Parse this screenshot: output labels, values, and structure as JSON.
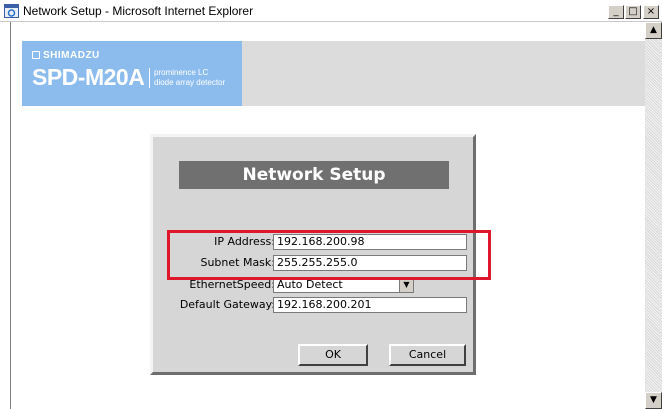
{
  "window": {
    "title": "Network Setup - Microsoft Internet Explorer",
    "buttons": {
      "minimize": "_",
      "maximize": "□",
      "close": "×"
    }
  },
  "scrollbar": {
    "up_arrow": "▲",
    "down_arrow": "▼"
  },
  "header": {
    "brand": "SHIMADZU",
    "model": "SPD-M20A",
    "tagline_1": "prominence LC",
    "tagline_2": "diode array detector",
    "colors": {
      "logo_bg": "#8cbcee",
      "bar_bg": "#dcdcdc"
    }
  },
  "dialog": {
    "title": "Network Setup",
    "fields": {
      "ip_address": {
        "label": "IP Address:",
        "value": "192.168.200.98"
      },
      "subnet_mask": {
        "label": "Subnet Mask:",
        "value": "255.255.255.0"
      },
      "ethernet_speed": {
        "label": "EthernetSpeed:",
        "value": "Auto Detect"
      },
      "default_gateway": {
        "label": "Default Gateway:",
        "value": "192.168.200.201"
      }
    },
    "ok_label": "OK",
    "cancel_label": "Cancel"
  },
  "highlight": {
    "color": "#e0162b"
  }
}
